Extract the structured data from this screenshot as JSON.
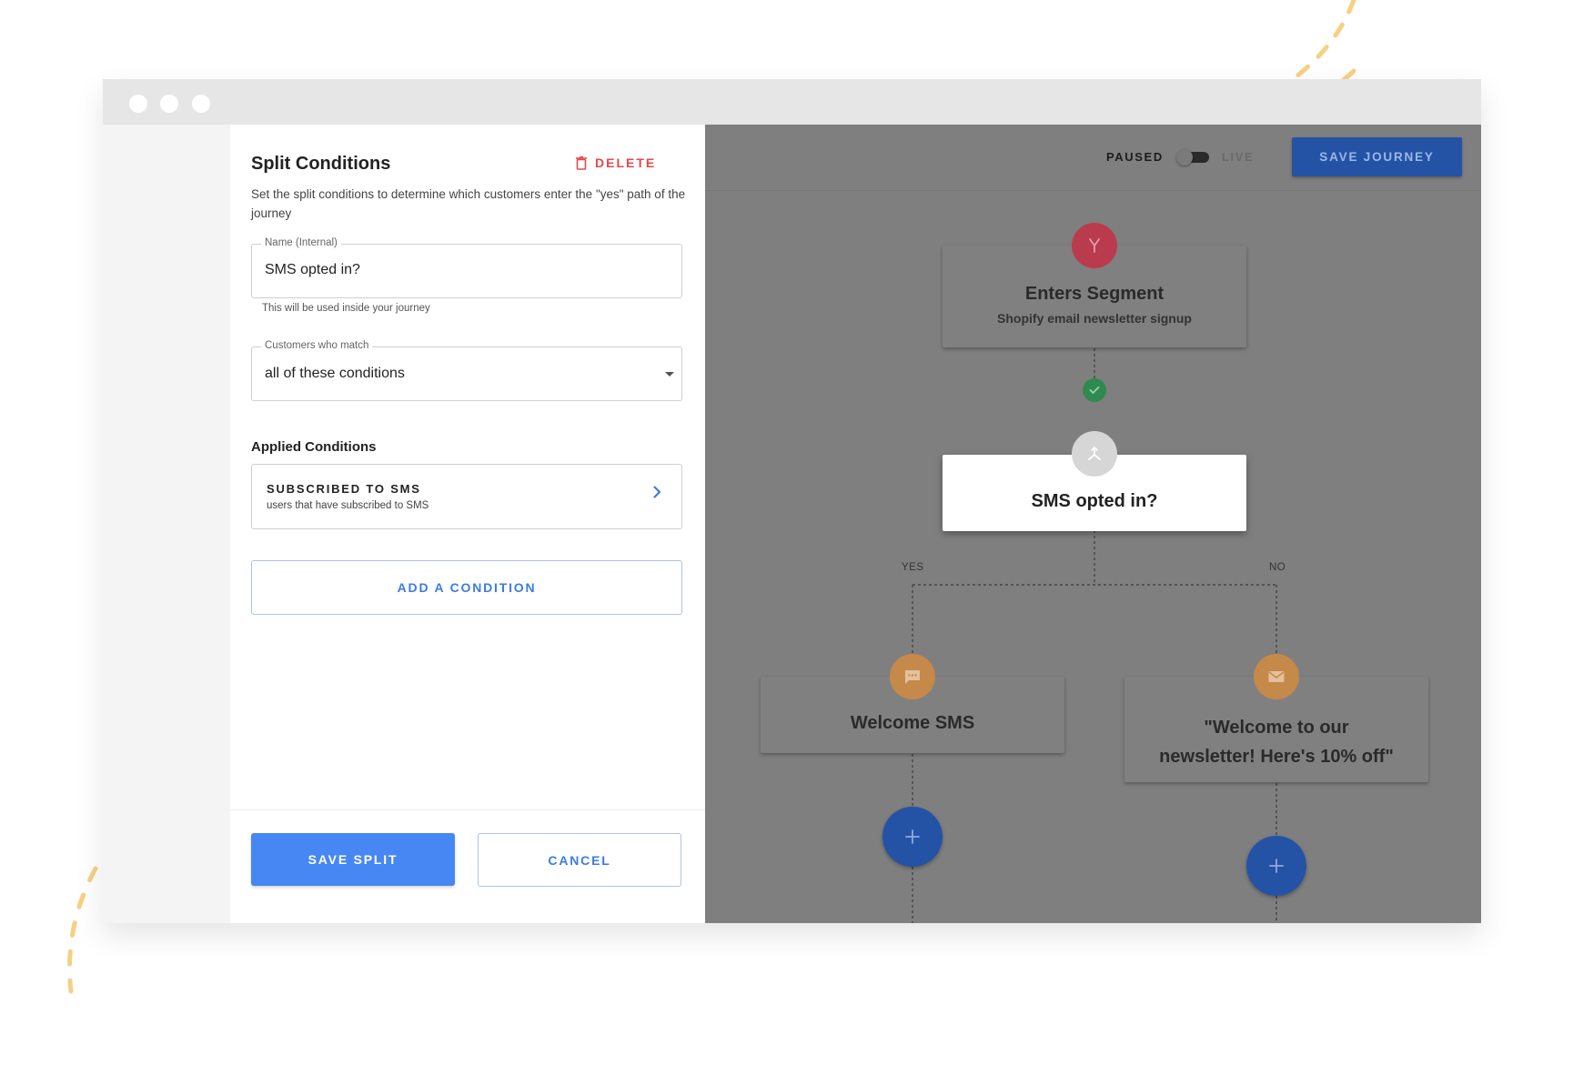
{
  "panel": {
    "title": "Split Conditions",
    "delete_label": "DELETE",
    "description": "Set the split conditions to determine which customers enter the \"yes\" path of the journey",
    "name_field": {
      "label": "Name (Internal)",
      "value": "SMS opted in?",
      "helper": "This will be used inside your journey"
    },
    "match_field": {
      "label": "Customers who match",
      "value": "all of these conditions"
    },
    "applied_title": "Applied Conditions",
    "conditions": [
      {
        "title": "SUBSCRIBED TO SMS",
        "subtitle": "users that have subscribed to SMS"
      }
    ],
    "add_condition_label": "ADD A CONDITION",
    "save_label": "SAVE SPLIT",
    "cancel_label": "CANCEL"
  },
  "toolbar": {
    "paused_label": "PAUSED",
    "live_label": "LIVE",
    "save_journey_label": "SAVE JOURNEY"
  },
  "flow": {
    "trigger": {
      "title": "Enters Segment",
      "subtitle": "Shopify email newsletter signup"
    },
    "split": {
      "title": "SMS opted in?"
    },
    "yes_label": "YES",
    "no_label": "NO",
    "yes_node": {
      "title": "Welcome SMS"
    },
    "no_node": {
      "title": "\"Welcome to our newsletter! Here's 10% off\""
    }
  },
  "colors": {
    "primary": "#4787f3",
    "danger": "#e5484d",
    "trigger_icon": "#b93b4d",
    "action_icon": "#c5894a",
    "success": "#2e8a50"
  },
  "icons": {
    "delete": "trash-icon",
    "condition_chevron": "chevron-right-icon",
    "trigger": "segment-split-icon",
    "split": "split-arrows-icon",
    "sms": "chat-bubble-icon",
    "email": "envelope-icon",
    "add": "plus-icon"
  }
}
